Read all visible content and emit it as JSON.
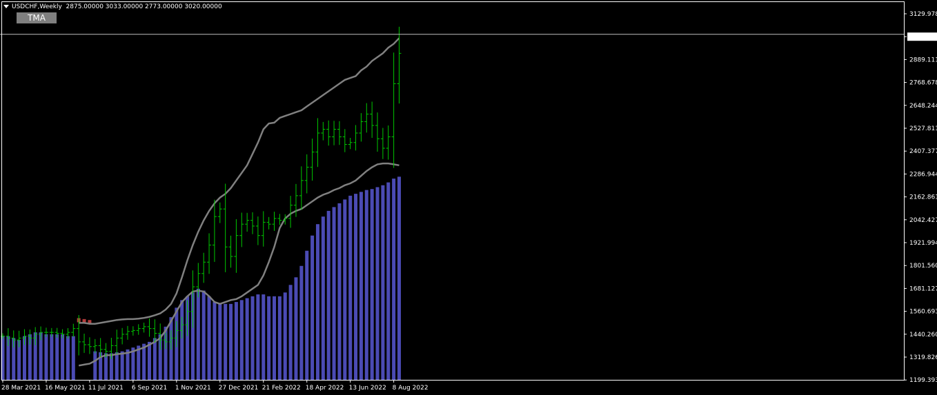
{
  "header": {
    "symbol": "USDCHF,Weekly",
    "ohlc": "2875.00000 3033.00000 2773.00000 3020.00000"
  },
  "indicator_button": {
    "label": "TMA"
  },
  "colors": {
    "background": "#000000",
    "bull_bar": "#00c800",
    "bands": "#808080",
    "histogram_blue": "#4b4bb4",
    "histogram_red": "#b43c3c",
    "price_line": "#c0c0c0"
  },
  "chart_data": {
    "type": "ohlc",
    "ylim": [
      1199.9,
      3190
    ],
    "y_ticks": [
      3129.9783,
      3020.0,
      2889.1117,
      2768.6782,
      2648.2447,
      2527.8112,
      2407.3777,
      2286.9442,
      2162.8612,
      2042.4277,
      1921.9942,
      1801.5607,
      1681.1272,
      1560.6937,
      1440.2602,
      1319.8267,
      1199.3932
    ],
    "y_tick_labels": [
      "3129.9783",
      "3020.0000",
      "2889.1117",
      "2768.6782",
      "2648.2447",
      "2527.8112",
      "2407.3777",
      "2286.9442",
      "2162.8612",
      "2042.4277",
      "1921.9942",
      "1801.5607",
      "1681.1272",
      "1560.6937",
      "1440.2602",
      "1319.8267",
      "1199.3932"
    ],
    "current_price": 3020.0,
    "current_price_label": "3020.0000",
    "x_labels": [
      "28 Mar 2021",
      "16 May 2021",
      "11 Jul 2021",
      "6 Sep 2021",
      "1 Nov 2021",
      "27 Dec 2021",
      "21 Feb 2022",
      "18 Apr 2022",
      "13 Jun 2022",
      "8 Aug 2022"
    ],
    "x_label_bar_index": [
      0,
      8,
      16,
      24,
      32,
      40,
      48,
      56,
      64,
      72
    ],
    "bar_count": 74,
    "close": [
      1430,
      1420,
      1410,
      1420,
      1430,
      1420,
      1440,
      1450,
      1450,
      1450,
      1445,
      1440,
      1450,
      1470,
      1400,
      1385,
      1375,
      1380,
      1360,
      1350,
      1380,
      1420,
      1440,
      1455,
      1460,
      1470,
      1480,
      1470,
      1445,
      1410,
      1400,
      1420,
      1460,
      1490,
      1560,
      1690,
      1760,
      1820,
      1910,
      2060,
      2100,
      1900,
      1850,
      1960,
      2020,
      2040,
      2010,
      1960,
      2030,
      2020,
      2050,
      2040,
      2050,
      2120,
      2170,
      2250,
      2320,
      2400,
      2500,
      2520,
      2480,
      2520,
      2480,
      2440,
      2450,
      2500,
      2560,
      2600,
      2540,
      2470,
      2420,
      2480,
      2760,
      2920
    ],
    "upper_band": [
      null,
      null,
      null,
      null,
      null,
      null,
      null,
      null,
      null,
      null,
      null,
      null,
      null,
      null,
      1500,
      1500,
      1495,
      1495,
      1500,
      1505,
      1510,
      1515,
      1518,
      1520,
      1520,
      1522,
      1526,
      1532,
      1540,
      1550,
      1570,
      1600,
      1655,
      1740,
      1830,
      1910,
      1980,
      2040,
      2090,
      2130,
      2160,
      2180,
      2210,
      2250,
      2290,
      2330,
      2390,
      2450,
      2520,
      2550,
      2555,
      2580,
      2590,
      2600,
      2610,
      2620,
      2640,
      2660,
      2680,
      2700,
      2720,
      2740,
      2760,
      2780,
      2790,
      2800,
      2830,
      2850,
      2880,
      2900,
      2920,
      2950,
      2970,
      3000
    ],
    "lower_band": [
      null,
      null,
      null,
      null,
      null,
      null,
      null,
      null,
      null,
      null,
      null,
      null,
      null,
      null,
      1275,
      1280,
      1285,
      1300,
      1320,
      1330,
      1330,
      1335,
      1338,
      1342,
      1350,
      1360,
      1370,
      1385,
      1400,
      1420,
      1460,
      1510,
      1560,
      1610,
      1640,
      1665,
      1670,
      1665,
      1640,
      1610,
      1600,
      1610,
      1620,
      1625,
      1640,
      1660,
      1680,
      1700,
      1750,
      1820,
      1900,
      2000,
      2050,
      2075,
      2090,
      2100,
      2120,
      2140,
      2160,
      2175,
      2185,
      2200,
      2210,
      2225,
      2235,
      2250,
      2275,
      2300,
      2320,
      2335,
      2340,
      2340,
      2335,
      2330
    ],
    "histogram": [
      1430,
      1430,
      1420,
      1410,
      1430,
      1440,
      1450,
      1450,
      1440,
      1440,
      1440,
      1440,
      1430,
      1430,
      -1525,
      -1520,
      -1515,
      1350,
      1345,
      1340,
      1340,
      1345,
      1350,
      1360,
      1370,
      1380,
      1390,
      1400,
      1420,
      1440,
      1480,
      1530,
      1580,
      1620,
      1640,
      1660,
      1680,
      1670,
      1640,
      1610,
      1600,
      1600,
      1600,
      1610,
      1620,
      1630,
      1640,
      1650,
      1650,
      1640,
      1640,
      1640,
      1660,
      1700,
      1740,
      1800,
      1880,
      1960,
      2020,
      2060,
      2090,
      2110,
      2130,
      2150,
      2170,
      2180,
      2190,
      2200,
      2205,
      2215,
      2225,
      2240,
      2260,
      2270
    ]
  }
}
